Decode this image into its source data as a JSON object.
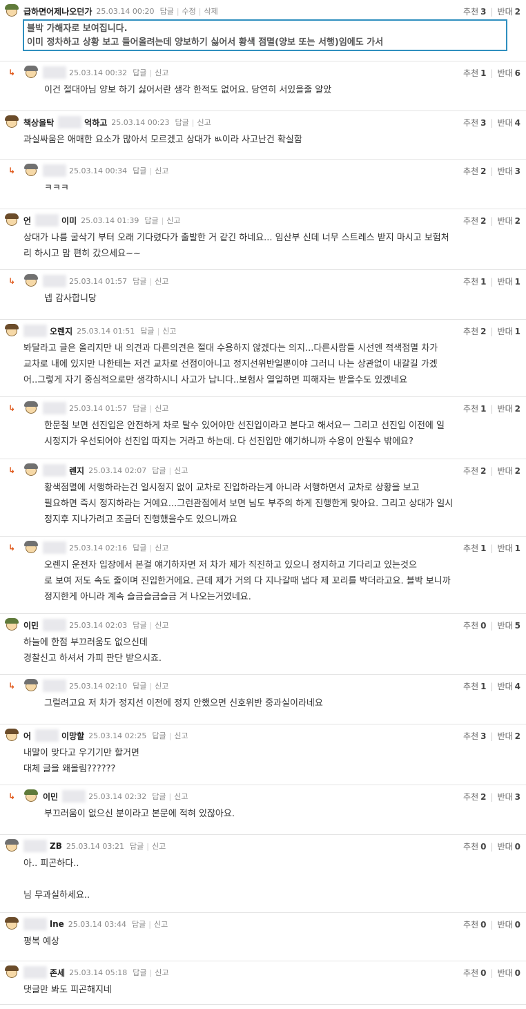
{
  "labels": {
    "reply": "답글",
    "report": "신고",
    "edit": "수정",
    "delete": "삭제",
    "recommend": "추천",
    "oppose": "반대"
  },
  "comments": [
    {
      "nick": "급하면어제나오던가",
      "date": "25.03.14 00:20",
      "up": "3",
      "down": "2",
      "avatar": "green",
      "quote": [
        "블박 가해자로 보여집니다.",
        "이미 정차하고 상황 보고 들어올려는데 양보하기 싫어서 황색 점멸(양보 또는 서행)임에도 가서"
      ]
    },
    {
      "nick": "",
      "date": "25.03.14 00:32",
      "up": "1",
      "down": "6",
      "avatar": "gray",
      "body": [
        "이건 절대아님 양보 하기 싫어서란 생각 한적도 없어요. 당연히 서있을줄 알았"
      ]
    },
    {
      "nick": "책상을탁",
      "nick2": "억하고",
      "date": "25.03.14 00:23",
      "up": "3",
      "down": "4",
      "avatar": "brown",
      "body": [
        "과실싸움은 애매한 요소가 많아서 모르겠고 상대가 ㅄ이라 사고난건 확실함"
      ]
    },
    {
      "nick": "",
      "date": "25.03.14 00:34",
      "up": "2",
      "down": "3",
      "avatar": "gray",
      "body": [
        "ㅋㅋㅋ"
      ]
    },
    {
      "nick": "언",
      "nick2": "이미",
      "date": "25.03.14 01:39",
      "up": "2",
      "down": "2",
      "avatar": "brown",
      "body": [
        "상대가 나름 굴삭기 부터 오래 기다렸다가 출발한 거 같긴 하네요... 임산부 신데 너무 스트레스 받지 마시고 보험처",
        "리 하시고 맘 편히 갔으세요~~"
      ]
    },
    {
      "nick": "",
      "date": "25.03.14 01:57",
      "up": "1",
      "down": "1",
      "avatar": "gray",
      "body": [
        "넵 감사합니당"
      ]
    },
    {
      "nick": "",
      "nick2": "오렌지",
      "date": "25.03.14 01:51",
      "up": "2",
      "down": "1",
      "avatar": "brown",
      "body": [
        "봐달라고 글은 올리지만 내 의견과 다른의견은 절대 수용하지 않겠다는 의지...다른사람들 시선엔 적색점멸 차가",
        "교차로 내에 있지만 나한테는 저건 교차로 선점이아니고 정지선위반일뿐이야 그러니 나는 상관없이 내갈길 가겠",
        "어..그렇게 자기 중심적으로만 생각하시니 사고가 납니다..보험사 열일하면 피해자는 받을수도 있겠네요"
      ]
    },
    {
      "nick": "",
      "date": "25.03.14 01:57",
      "up": "1",
      "down": "2",
      "avatar": "gray",
      "body": [
        "한문철 보면 선진입은 안전하게 차로 탈수 있어야만 선진입이라고 본다고 해서요ㅡ 그리고 선진입 이전에 일",
        "시정지가 우선되어야 선진입 따지는 거라고 하는데. 다 선진입만 얘기하니까 수용이 안될수 밖에요?"
      ]
    },
    {
      "nick": "",
      "nick2": "렌지",
      "date": "25.03.14 02:07",
      "up": "2",
      "down": "2",
      "avatar": "gray",
      "body": [
        "황색점멸에 서행하라는건 일시정지 없이 교차로 진입하라는게 아니라 서행하면서 교차로 상황을 보고",
        "필요하면 즉시 정지하라는 거예요...그런관점에서 보면 님도 부주의 하게 진행한게 맞아요. 그리고 상대가 일시",
        "정지후 지나가려고 조금더 진행했을수도 있으니까요"
      ]
    },
    {
      "nick": "",
      "date": "25.03.14 02:16",
      "up": "1",
      "down": "1",
      "avatar": "gray",
      "body": [
        "오렌지 운전자 입장에서 본걸 얘기하자면 저 차가 제가 직진하고 있으니 정지하고 기다리고 있는것으",
        "로 보여 저도 속도 줄이며 진입한거에요. 근데 제가 거의 다 지나갈때 냅다 제 꼬리를 박더라고요. 블박 보니까",
        "정지한게 아니라 계속 슬금슬금슬금 겨 나오는거였네요."
      ]
    },
    {
      "nick": "이민",
      "date": "25.03.14 02:03",
      "up": "0",
      "down": "5",
      "avatar": "green",
      "body": [
        "하늘에 한점 부끄러움도 없으신데",
        "경찰신고 하셔서 가피 판단 받으시죠."
      ]
    },
    {
      "nick": "",
      "date": "25.03.14 02:10",
      "up": "1",
      "down": "4",
      "avatar": "gray",
      "body": [
        "그럴려고요 저 차가 정지선 이전에 정지 안했으면 신호위반 중과실이라네요"
      ]
    },
    {
      "nick": "어",
      "nick2": "이망할",
      "date": "25.03.14 02:25",
      "up": "3",
      "down": "2",
      "avatar": "brown",
      "body": [
        "내말이 맞다고 우기기만 할거면",
        "대체 글을 왜올림??????"
      ]
    },
    {
      "nick": "이민",
      "date": "25.03.14 02:32",
      "up": "2",
      "down": "3",
      "avatar": "green",
      "body": [
        "부끄러움이 없으신 분이라고 본문에 적혀 있잖아요."
      ]
    },
    {
      "nick": "ZB",
      "date": "25.03.14 03:21",
      "up": "0",
      "down": "0",
      "avatar": "gray",
      "body": [
        "아.. 피곤하다..",
        "",
        "님 무과실하세요.."
      ]
    },
    {
      "nick": "lne",
      "date": "25.03.14 03:44",
      "up": "0",
      "down": "0",
      "avatar": "brown",
      "body": [
        "평복 예상"
      ]
    },
    {
      "nick": "존세",
      "date": "25.03.14 05:18",
      "up": "0",
      "down": "0",
      "avatar": "brown",
      "body": [
        "댓글만 봐도 피곤해지네"
      ]
    }
  ]
}
